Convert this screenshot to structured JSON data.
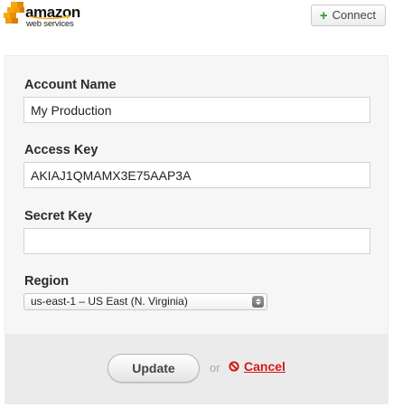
{
  "header": {
    "logo": {
      "brand": "amazon",
      "sub": "web services"
    },
    "connect_button": {
      "icon": "plus-icon",
      "label": "Connect"
    }
  },
  "form": {
    "account_name": {
      "label": "Account Name",
      "value": "My Production"
    },
    "access_key": {
      "label": "Access Key",
      "value": "AKIAJ1QMAMX3E75AAP3A"
    },
    "secret_key": {
      "label": "Secret Key",
      "value": ""
    },
    "region": {
      "label": "Region",
      "selected": "us-east-1 – US East (N. Virginia)"
    }
  },
  "footer": {
    "update_label": "Update",
    "or_text": "or",
    "cancel_label": "Cancel",
    "cancel_icon": "no-entry-icon"
  },
  "colors": {
    "aws_orange": "#f7a80d",
    "plus_green": "#2d9a2d",
    "cancel_red": "#d51a1a",
    "panel_bg": "#f6f6f6",
    "footer_bg": "#ebebeb"
  }
}
